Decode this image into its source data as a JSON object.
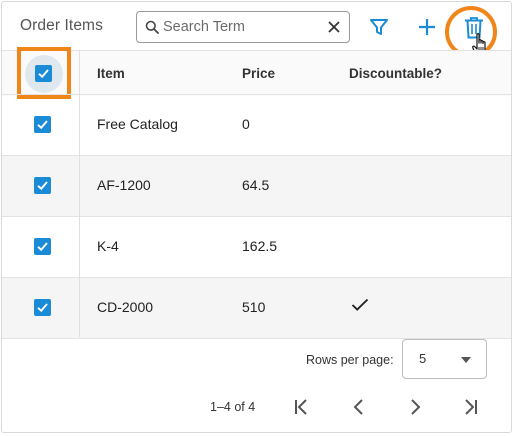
{
  "toolbar": {
    "title": "Order Items",
    "search_placeholder": "Search Term",
    "filter_icon": "filter-icon",
    "add_icon": "plus-icon",
    "delete_icon": "trash-icon"
  },
  "table": {
    "columns": [
      "Item",
      "Price",
      "Discountable?"
    ],
    "rows": [
      {
        "item": "Free Catalog",
        "price": "0",
        "discountable": false,
        "selected": true
      },
      {
        "item": "AF-1200",
        "price": "64.5",
        "discountable": false,
        "selected": true
      },
      {
        "item": "K-4",
        "price": "162.5",
        "discountable": false,
        "selected": true
      },
      {
        "item": "CD-2000",
        "price": "510",
        "discountable": true,
        "selected": true
      }
    ],
    "header_checkbox_checked": true
  },
  "footer": {
    "rows_per_page_label": "Rows per page:",
    "rows_per_page_value": "5",
    "range": "1–4 of 4"
  },
  "colors": {
    "accent": "#1a8bd6",
    "highlight": "#f0861a"
  }
}
